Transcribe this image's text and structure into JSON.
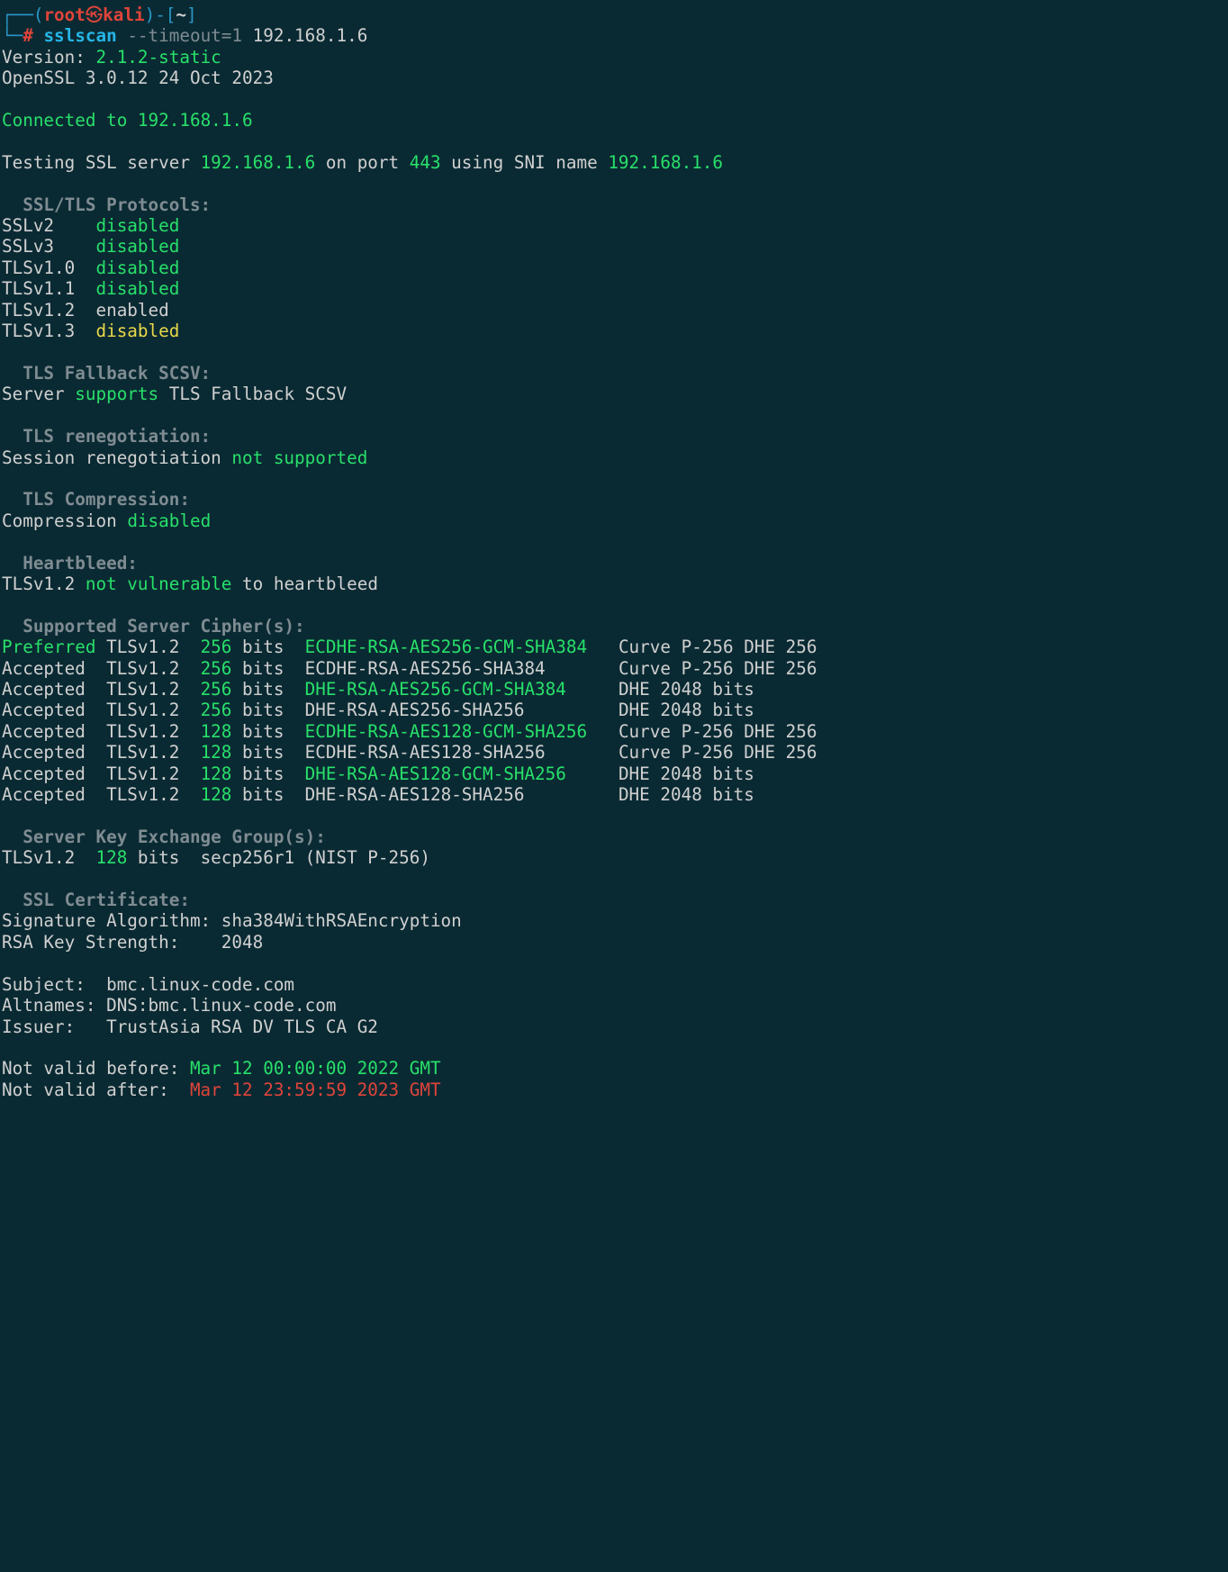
{
  "prompt": {
    "user": "root",
    "host": "kali",
    "symbol_at": "㉿",
    "dir": "~",
    "hash": "#",
    "command_tool": "sslscan",
    "command_opt": "--timeout=1",
    "command_target": "192.168.1.6"
  },
  "version": {
    "label": "Version:",
    "value": "2.1.2-static",
    "openssl": "OpenSSL 3.0.12 24 Oct 2023"
  },
  "connected": {
    "text1": "Connected to ",
    "ip": "192.168.1.6"
  },
  "testing": {
    "pre": "Testing SSL server ",
    "ip": "192.168.1.6",
    "mid1": " on port ",
    "port": "443",
    "mid2": " using SNI name ",
    "sni": "192.168.1.6"
  },
  "headers": {
    "protocols": "  SSL/TLS Protocols:",
    "fallback": "  TLS Fallback SCSV:",
    "reneg": "  TLS renegotiation:",
    "compression": "  TLS Compression:",
    "heartbleed": "  Heartbleed:",
    "ciphers": "  Supported Server Cipher(s):",
    "kex": "  Server Key Exchange Group(s):",
    "cert": "  SSL Certificate:"
  },
  "protocols": [
    {
      "name": "SSLv2    ",
      "status": "disabled",
      "cls": "green"
    },
    {
      "name": "SSLv3    ",
      "status": "disabled",
      "cls": "green"
    },
    {
      "name": "TLSv1.0  ",
      "status": "disabled",
      "cls": "green"
    },
    {
      "name": "TLSv1.1  ",
      "status": "disabled",
      "cls": "green"
    },
    {
      "name": "TLSv1.2  ",
      "status": "enabled",
      "cls": "white"
    },
    {
      "name": "TLSv1.3  ",
      "status": "disabled",
      "cls": "yellow"
    }
  ],
  "fallback": {
    "pre": "Server ",
    "val": "supports",
    "post": " TLS Fallback SCSV"
  },
  "reneg": {
    "pre": "Session renegotiation ",
    "val": "not supported"
  },
  "compression": {
    "pre": "Compression ",
    "val": "disabled"
  },
  "heartbleed": {
    "pre": "TLSv1.2 ",
    "val": "not vulnerable",
    "post": " to heartbleed"
  },
  "ciphers": [
    {
      "pref": "Preferred",
      "prefcls": "green",
      "tls": "TLSv1.2",
      "bits": "256",
      "bitscls": "green",
      "cipher": "ECDHE-RSA-AES256-GCM-SHA384",
      "ciphercls": "green",
      "extra": "Curve ",
      "extra2": "P-256",
      "extra3": " DHE 256"
    },
    {
      "pref": "Accepted ",
      "prefcls": "white",
      "tls": "TLSv1.2",
      "bits": "256",
      "bitscls": "green",
      "cipher": "ECDHE-RSA-AES256-SHA384",
      "ciphercls": "white",
      "extra": "Curve ",
      "extra2": "P-256",
      "extra3": " DHE 256"
    },
    {
      "pref": "Accepted ",
      "prefcls": "white",
      "tls": "TLSv1.2",
      "bits": "256",
      "bitscls": "green",
      "cipher": "DHE-RSA-AES256-GCM-SHA384",
      "ciphercls": "green",
      "extra": "DHE ",
      "extra2": "2048",
      "extra3": " bits"
    },
    {
      "pref": "Accepted ",
      "prefcls": "white",
      "tls": "TLSv1.2",
      "bits": "256",
      "bitscls": "green",
      "cipher": "DHE-RSA-AES256-SHA256",
      "ciphercls": "white",
      "extra": "DHE ",
      "extra2": "2048",
      "extra3": " bits"
    },
    {
      "pref": "Accepted ",
      "prefcls": "white",
      "tls": "TLSv1.2",
      "bits": "128",
      "bitscls": "green",
      "cipher": "ECDHE-RSA-AES128-GCM-SHA256",
      "ciphercls": "green",
      "extra": "Curve ",
      "extra2": "P-256",
      "extra3": " DHE 256"
    },
    {
      "pref": "Accepted ",
      "prefcls": "white",
      "tls": "TLSv1.2",
      "bits": "128",
      "bitscls": "green",
      "cipher": "ECDHE-RSA-AES128-SHA256",
      "ciphercls": "white",
      "extra": "Curve ",
      "extra2": "P-256",
      "extra3": " DHE 256"
    },
    {
      "pref": "Accepted ",
      "prefcls": "white",
      "tls": "TLSv1.2",
      "bits": "128",
      "bitscls": "green",
      "cipher": "DHE-RSA-AES128-GCM-SHA256",
      "ciphercls": "green",
      "extra": "DHE ",
      "extra2": "2048",
      "extra3": " bits"
    },
    {
      "pref": "Accepted ",
      "prefcls": "white",
      "tls": "TLSv1.2",
      "bits": "128",
      "bitscls": "green",
      "cipher": "DHE-RSA-AES128-SHA256",
      "ciphercls": "white",
      "extra": "DHE ",
      "extra2": "2048",
      "extra3": " bits"
    }
  ],
  "cipher_pad": 29,
  "kex": {
    "tls": "TLSv1.2",
    "bits": "128",
    "bits_label": "bits",
    "name": "secp256r1 (NIST P-256)"
  },
  "cert": {
    "sig_label": "Signature Algorithm: ",
    "sig": "sha384WithRSAEncryption",
    "rsa_label": "RSA Key Strength:    ",
    "rsa": "2048",
    "subject_label": "Subject:  ",
    "subject": "bmc.linux-code.com",
    "altnames_label": "Altnames: ",
    "altnames": "DNS:bmc.linux-code.com",
    "issuer_label": "Issuer:   ",
    "issuer": "TrustAsia RSA DV TLS CA G2",
    "nvb_label": "Not valid before: ",
    "nvb": "Mar 12 00:00:00 2022 GMT",
    "nva_label": "Not valid after:  ",
    "nva": "Mar 12 23:59:59 2023 GMT"
  }
}
